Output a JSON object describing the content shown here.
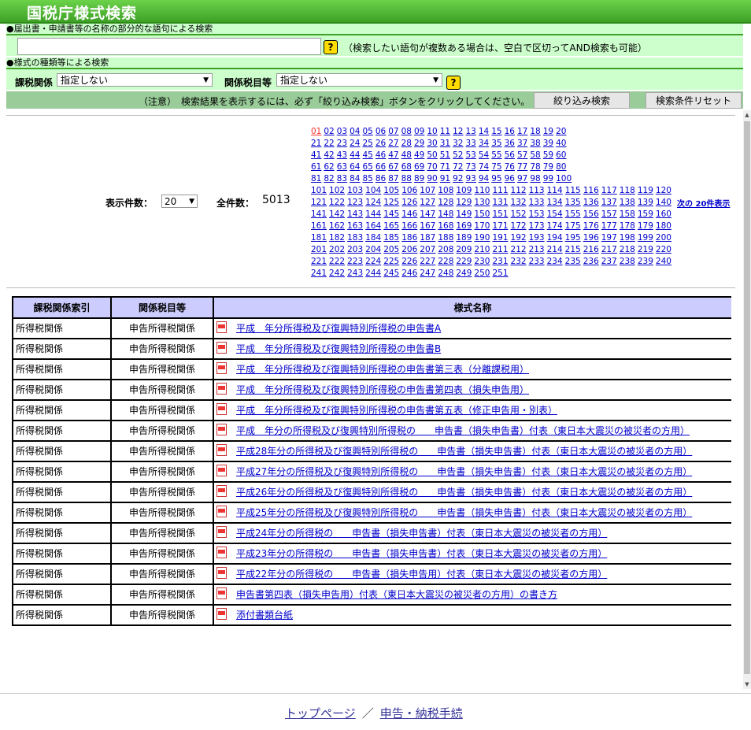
{
  "title": "国税庁様式検索",
  "search": {
    "section1": "●届出書・申請書等の名称の部分的な語句による検索",
    "keyword_value": "",
    "keyword_note": "（検索したい語句が複数ある場合は、空白で区切ってAND検索も可能）",
    "section2": "●様式の種類等による検索",
    "tax_label": "課税関係",
    "tax_value": "指定しない",
    "item_label": "関係税目等",
    "item_value": "指定しない",
    "help_glyph": "?",
    "notice": "（注意）　検索結果を表示するには、必ず「絞り込み検索」ボタンをクリックしてください。",
    "filter_button": "絞り込み検索",
    "reset_button": "検索条件リセット"
  },
  "pager": {
    "per_page_label": "表示件数：",
    "per_page_value": "20",
    "total_label": "全件数：",
    "total_value": "5013",
    "current_page": "01",
    "page_count": 251,
    "next_label": "次の 20件表示"
  },
  "table": {
    "headers": [
      "課税関係索引",
      "関係税目等",
      "様式名称"
    ],
    "rows": [
      [
        "所得税関係",
        "申告所得税関係",
        "平成　年分所得税及び復興特別所得税の申告書A"
      ],
      [
        "所得税関係",
        "申告所得税関係",
        "平成　年分所得税及び復興特別所得税の申告書B"
      ],
      [
        "所得税関係",
        "申告所得税関係",
        "平成　年分所得税及び復興特別所得税の申告書第三表（分離課税用）"
      ],
      [
        "所得税関係",
        "申告所得税関係",
        "平成　年分所得税及び復興特別所得税の申告書第四表（損失申告用）"
      ],
      [
        "所得税関係",
        "申告所得税関係",
        "平成　年分所得税及び復興特別所得税の申告書第五表（修正申告用・別表）"
      ],
      [
        "所得税関係",
        "申告所得税関係",
        "平成　年分の所得税及び復興特別所得税の　　申告書（損失申告書）付表（東日本大震災の被災者の方用）"
      ],
      [
        "所得税関係",
        "申告所得税関係",
        "平成28年分の所得税及び復興特別所得税の　　申告書（損失申告書）付表（東日本大震災の被災者の方用）"
      ],
      [
        "所得税関係",
        "申告所得税関係",
        "平成27年分の所得税及び復興特別所得税の　　申告書（損失申告書）付表（東日本大震災の被災者の方用）"
      ],
      [
        "所得税関係",
        "申告所得税関係",
        "平成26年分の所得税及び復興特別所得税の　　申告書（損失申告書）付表（東日本大震災の被災者の方用）"
      ],
      [
        "所得税関係",
        "申告所得税関係",
        "平成25年分の所得税及び復興特別所得税の　　申告書（損失申告書）付表（東日本大震災の被災者の方用）"
      ],
      [
        "所得税関係",
        "申告所得税関係",
        "平成24年分の所得税の　　申告書（損失申告書）付表（東日本大震災の被災者の方用）"
      ],
      [
        "所得税関係",
        "申告所得税関係",
        "平成23年分の所得税の　　申告書（損失申告書）付表（東日本大震災の被災者の方用）"
      ],
      [
        "所得税関係",
        "申告所得税関係",
        "平成22年分の所得税の　　申告書（損失申告用）付表（東日本大震災の被災者の方用）"
      ],
      [
        "所得税関係",
        "申告所得税関係",
        "申告書第四表（損失申告用）付表（東日本大震災の被災者の方用）の書き方"
      ],
      [
        "所得税関係",
        "申告所得税関係",
        "添付書類台紙"
      ]
    ]
  },
  "footer": {
    "top_link": "トップページ",
    "separator": "／",
    "tax_link": "申告・納税手続"
  }
}
